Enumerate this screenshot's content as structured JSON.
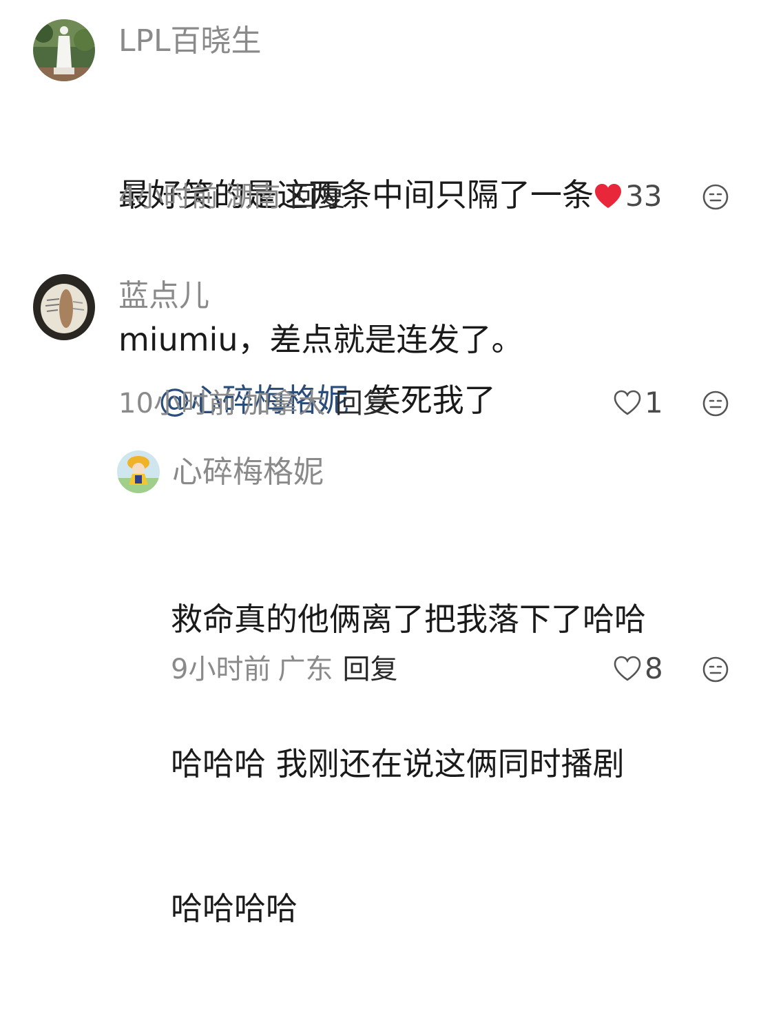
{
  "comments": [
    {
      "username": "LPL百晓生",
      "content_lines": [
        "最好笑的是这两条中间只隔了一条",
        "miumiu，差点就是连发了。"
      ],
      "time": "4小时前",
      "location": "湖南",
      "reply_label": "回复",
      "likes": "33",
      "liked": true,
      "avatar_icon": "statue-avatar-icon"
    },
    {
      "username": "蓝点儿",
      "mention": "@心碎梅格妮",
      "content": "笑死我了",
      "time": "10小时前",
      "location": "加拿大",
      "reply_label": "回复",
      "likes": "1",
      "liked": false,
      "avatar_icon": "apple-avatar-icon"
    },
    {
      "username": "心碎梅格妮",
      "content_lines": [
        "救命真的他俩离了把我落下了哈哈",
        "哈哈哈 我刚还在说这俩同时播剧",
        "哈哈哈哈"
      ],
      "time": "9小时前",
      "location": "广东",
      "reply_label": "回复",
      "likes": "8",
      "liked": false,
      "avatar_icon": "cartoon-girl-avatar-icon"
    }
  ],
  "colors": {
    "username": "#8a8a8a",
    "text": "#1a1a1a",
    "mention": "#2a4d7a",
    "like_active": "#e8273b",
    "meta": "#8a8a8a"
  }
}
